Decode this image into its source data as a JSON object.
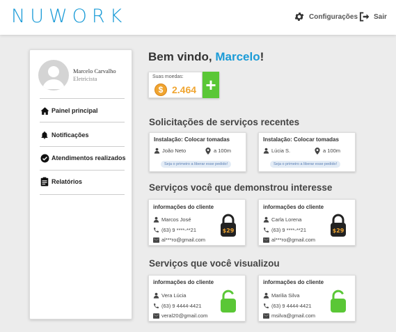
{
  "header": {
    "logo": "NUWORK",
    "settings_label": "Configurações",
    "logout_label": "Sair"
  },
  "sidebar": {
    "user_name": "Marcelo Carvalho",
    "user_role": "Eletricista",
    "items": [
      {
        "label": "Painel principal",
        "icon": "home-icon"
      },
      {
        "label": "Notificações",
        "icon": "bell-icon"
      },
      {
        "label": "Atendimentos realizados",
        "icon": "check-circle-icon"
      },
      {
        "label": "Relatórios",
        "icon": "clipboard-icon"
      }
    ]
  },
  "main": {
    "welcome_prefix": "Bem vindo, ",
    "welcome_name": "Marcelo",
    "welcome_suffix": "!",
    "coins_label": "Suas moedas:",
    "coins_value": "2.464",
    "coin_symbol": "$",
    "add_label": "+",
    "recent_title": "Solicitações de serviços recentes",
    "recent": [
      {
        "title": "Instalação: Colocar tomadas",
        "client": "João Neto",
        "distance": "a 100m",
        "pill": "Seja o primeiro a liberar esse pedido!"
      },
      {
        "title": "Instalação: Colocar tomadas",
        "client": "Lúcia S.",
        "distance": "a 100m",
        "pill": "Seja o primeiro a liberar esse pedido!"
      }
    ],
    "interest_title": "Serviços você que demonstrou interesse",
    "interest": [
      {
        "title": "informações do cliente",
        "name": "Marcos José",
        "phone": "(63) 9 ****-**21",
        "email": "al***ro@gmail.com",
        "lock_cost": "29",
        "locked": true
      },
      {
        "title": "informações do cliente",
        "name": "Carla Lorena",
        "phone": "(63) 9 ****-**21",
        "email": "al***ro@gmail.com",
        "lock_cost": "29",
        "locked": true
      }
    ],
    "viewed_title": "Serviços que você visualizou",
    "viewed": [
      {
        "title": "informações do cliente",
        "name": "Vera Lúcia",
        "phone": "(63) 9 4444-4421",
        "email": "veral20@gmail.com",
        "locked": false
      },
      {
        "title": "informações do cliente",
        "name": "Marilia Silva",
        "phone": "(63) 9 4444-4421",
        "email": "msilva@gmail.com",
        "locked": false
      }
    ]
  },
  "colors": {
    "brand": "#1a9bd7",
    "coin": "#f0a531",
    "add": "#5ac736",
    "unlocked": "#5ac736",
    "locked": "#222222"
  }
}
